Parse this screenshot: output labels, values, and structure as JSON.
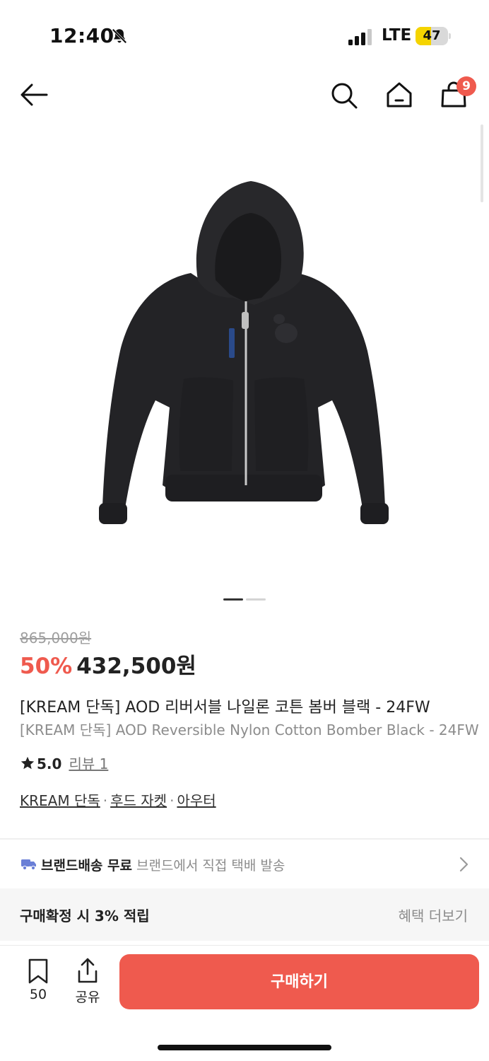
{
  "status_bar": {
    "time": "12:40",
    "network": "LTE",
    "battery": "47",
    "battery_level": 0.47,
    "icons": [
      "bell-slash-icon",
      "signal-icon",
      "battery-icon"
    ]
  },
  "nav": {
    "icons": [
      "back-arrow-icon",
      "search-icon",
      "home-icon",
      "shopping-bag-icon"
    ],
    "cart_count": "9"
  },
  "product": {
    "image_pages": 2,
    "image_active_page": 1,
    "original_price": "865,000원",
    "discount": "50%",
    "price": "432,500원",
    "title_ko": "[KREAM 단독] AOD 리버서블 나일론 코튼 봄버 블랙 - 24FW",
    "title_en": "[KREAM 단독] AOD Reversible Nylon Cotton Bomber Black - 24FW",
    "rating": "5.0",
    "review_link": "리뷰 1",
    "categories": [
      "KREAM 단독",
      "후드 자켓",
      "아우터"
    ],
    "separator": "·"
  },
  "shipping": {
    "main": "브랜드배송 무료",
    "sub": "브랜드에서 직접 택배 발송"
  },
  "benefit": {
    "text": "구매확정 시 3% 적립",
    "more": "혜택 더보기"
  },
  "bottom_bar": {
    "bookmark_count": "50",
    "share_label": "공유",
    "buy_label": "구매하기"
  },
  "colors": {
    "accent": "#ef5a4e",
    "battery": "#f5d400"
  }
}
